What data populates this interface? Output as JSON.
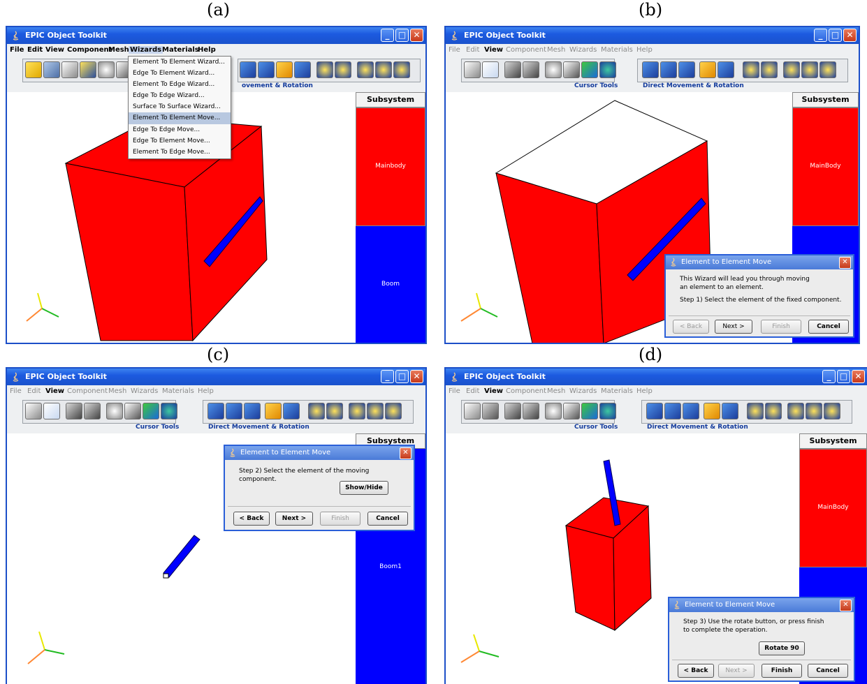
{
  "captions": {
    "a": "(a)",
    "b": "(b)",
    "c": "(c)",
    "d": "(d)"
  },
  "window": {
    "title": "EPIC Object Toolkit"
  },
  "menu": {
    "file": "File",
    "edit": "Edit",
    "view": "View",
    "component": "Component",
    "mesh": "Mesh",
    "wizards": "Wizards",
    "materials": "Materials",
    "help": "Help"
  },
  "toolbar": {
    "cursor_tools": "Cursor Tools",
    "direct_movement": "Direct Movement & Rotation",
    "direct_movement_partial": "ovement & Rotation"
  },
  "wizards_menu": {
    "items": [
      "Element To Element Wizard...",
      "Edge To Element Wizard...",
      "Element To Edge Wizard...",
      "Edge To Edge Wizard...",
      "Surface To Surface Wizard...",
      "Element To Element Move...",
      "Edge To Edge Move...",
      "Edge To Element Move...",
      "Element To Edge Move..."
    ],
    "selected_index": 5
  },
  "subsystem": {
    "header": "Subsystem",
    "a": {
      "top": "Mainbody",
      "bottom": "Boom"
    },
    "b": {
      "top": "MainBody"
    },
    "c": {
      "bottom": "Boom1"
    },
    "d": {
      "top": "MainBody"
    }
  },
  "colors": {
    "mainbody": "#ff0000",
    "boom": "#0000ff",
    "accent": "#1c4fc8"
  },
  "dialog": {
    "title_b": "Element to Element Move",
    "title_cd": "Element to Element Move",
    "b_line1": "This Wizard will lead you through moving",
    "b_line2": "an element to an element.",
    "b_step": "Step 1)  Select the element of the fixed component.",
    "c_step": "Step 2)  Select the element of the moving component.",
    "c_showhide": "Show/Hide",
    "d_step1": "Step 3)  Use the rotate button, or press finish",
    "d_step2": "to complete the operation.",
    "d_rotate": "Rotate 90",
    "back": "< Back",
    "next": "Next >",
    "finish": "Finish",
    "cancel": "Cancel"
  }
}
